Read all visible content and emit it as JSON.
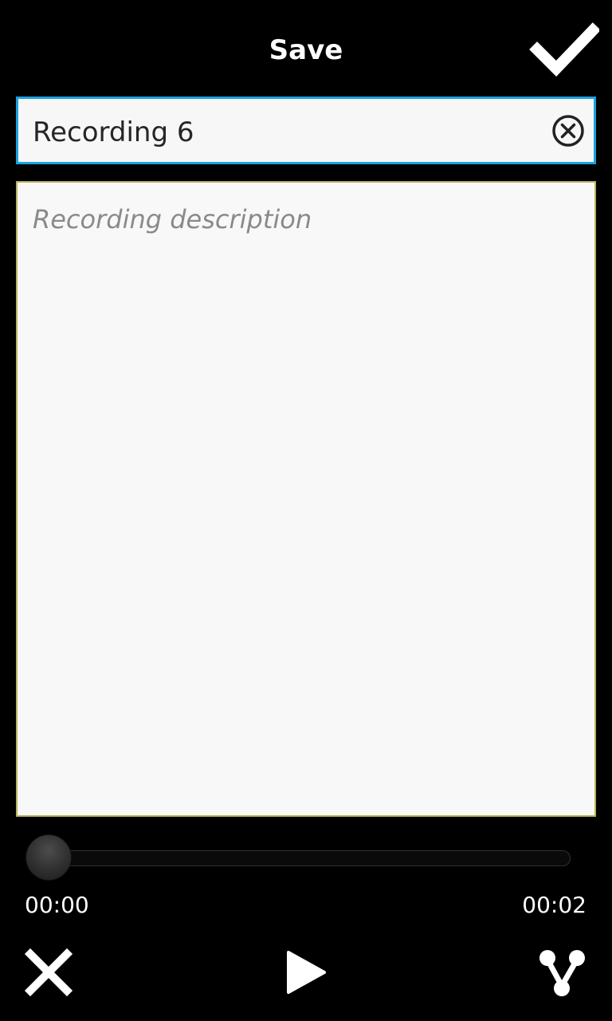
{
  "header": {
    "title": "Save",
    "confirm_icon": "checkmark-icon"
  },
  "form": {
    "title_value": "Recording 6",
    "clear_icon": "clear-circle-x-icon",
    "description_placeholder": "Recording description",
    "description_value": ""
  },
  "player": {
    "current_time": "00:00",
    "total_time": "00:02",
    "progress": 0
  },
  "toolbar": {
    "cancel_icon": "close-x-icon",
    "play_icon": "play-icon",
    "share_icon": "share-icon"
  },
  "colors": {
    "background": "#000000",
    "accent_focus": "#1ba1e2",
    "description_border": "#b8b25e",
    "field_bg": "#f7f7f7"
  }
}
